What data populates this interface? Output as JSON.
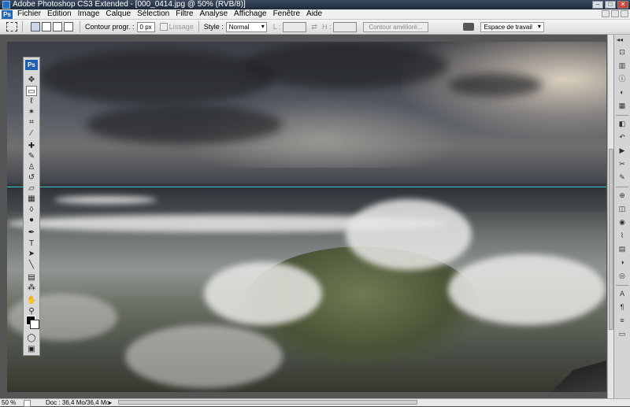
{
  "window": {
    "title": "Adobe Photoshop CS3 Extended - [000_0414.jpg @ 50% (RVB/8)]",
    "buttons": [
      "minimize",
      "maximize",
      "close"
    ]
  },
  "menu": {
    "logo": "Ps",
    "items": [
      "Fichier",
      "Edition",
      "Image",
      "Calque",
      "Sélection",
      "Filtre",
      "Analyse",
      "Affichage",
      "Fenêtre",
      "Aide"
    ]
  },
  "options": {
    "feather_label": "Contour progr. :",
    "feather_value": "0 px",
    "antialias_label": "Lissage",
    "style_label": "Style :",
    "style_value": "Normal",
    "width_label": "L :",
    "height_label": "H :",
    "refine_button": "Contour amélioré...",
    "workspace_button": "Espace de travail"
  },
  "toolbox": {
    "badge": "Ps",
    "tools": [
      {
        "name": "move-tool",
        "glyph": "✥"
      },
      {
        "name": "marquee-tool",
        "glyph": "▭",
        "active": true
      },
      {
        "name": "lasso-tool",
        "glyph": "ℓ"
      },
      {
        "name": "magic-wand-tool",
        "glyph": "✶"
      },
      {
        "name": "crop-tool",
        "glyph": "⌗"
      },
      {
        "name": "slice-tool",
        "glyph": "⁄"
      },
      {
        "name": "healing-brush-tool",
        "glyph": "✚"
      },
      {
        "name": "brush-tool",
        "glyph": "✎"
      },
      {
        "name": "clone-stamp-tool",
        "glyph": "♙"
      },
      {
        "name": "history-brush-tool",
        "glyph": "↺"
      },
      {
        "name": "eraser-tool",
        "glyph": "▱"
      },
      {
        "name": "gradient-tool",
        "glyph": "▦"
      },
      {
        "name": "blur-tool",
        "glyph": "◊"
      },
      {
        "name": "dodge-tool",
        "glyph": "●"
      },
      {
        "name": "pen-tool",
        "glyph": "✒"
      },
      {
        "name": "type-tool",
        "glyph": "T"
      },
      {
        "name": "path-selection-tool",
        "glyph": "➤"
      },
      {
        "name": "line-tool",
        "glyph": "╲"
      },
      {
        "name": "notes-tool",
        "glyph": "▤"
      },
      {
        "name": "eyedropper-tool",
        "glyph": "⁂"
      },
      {
        "name": "hand-tool",
        "glyph": "✋"
      },
      {
        "name": "zoom-tool",
        "glyph": "⚲"
      }
    ],
    "mode_glyphs": [
      "◯",
      "▣"
    ]
  },
  "dock": {
    "collapse_glyph": "◂◂",
    "icons": [
      {
        "name": "navigator-icon",
        "glyph": "⊡"
      },
      {
        "name": "histogram-icon",
        "glyph": "▥"
      },
      {
        "name": "info-icon",
        "glyph": "ⓘ"
      },
      {
        "name": "color-icon",
        "glyph": "◐"
      },
      {
        "name": "swatches-icon",
        "glyph": "▦"
      },
      {
        "name": "styles-icon",
        "glyph": "◧"
      },
      {
        "name": "history-icon",
        "glyph": "↶"
      },
      {
        "name": "actions-icon",
        "glyph": "▶"
      },
      {
        "name": "tool-presets-icon",
        "glyph": "✂"
      },
      {
        "name": "brushes-icon",
        "glyph": "✎"
      },
      {
        "name": "clone-source-icon",
        "glyph": "⊕"
      },
      {
        "name": "layers-icon",
        "glyph": "◫"
      },
      {
        "name": "channels-icon",
        "glyph": "◉"
      },
      {
        "name": "paths-icon",
        "glyph": "⌇"
      },
      {
        "name": "layer-comps-icon",
        "glyph": "▤"
      },
      {
        "name": "adjustments-icon",
        "glyph": "◑"
      },
      {
        "name": "masks-icon",
        "glyph": "◎"
      },
      {
        "name": "character-icon",
        "glyph": "A"
      },
      {
        "name": "paragraph-icon",
        "glyph": "¶"
      },
      {
        "name": "measurement-icon",
        "glyph": "≡"
      },
      {
        "name": "animation-icon",
        "glyph": "▭"
      }
    ]
  },
  "status": {
    "zoom": "50 %",
    "doc": "Doc : 36,4 Mo/36,4 Mo",
    "arrow": "▸"
  },
  "colors": {
    "guide": "#3fd0d0",
    "foreground": "#000000",
    "background": "#ffffff"
  }
}
